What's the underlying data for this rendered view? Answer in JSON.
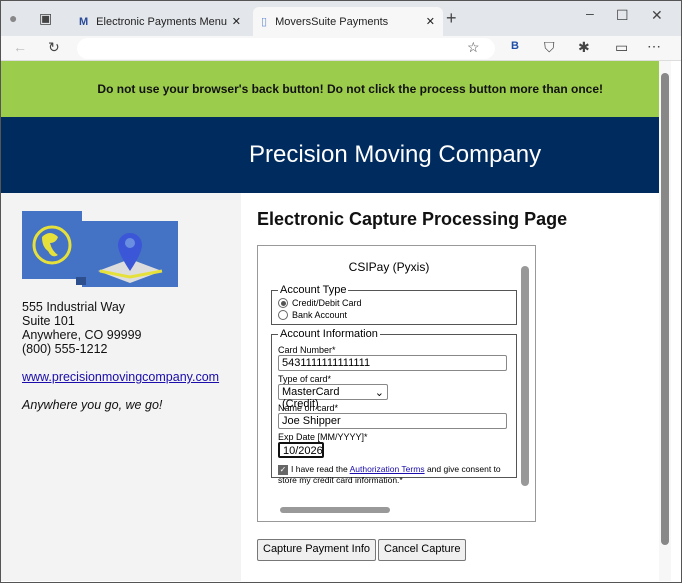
{
  "browser": {
    "tabs": [
      {
        "label": "Electronic Payments Menu"
      },
      {
        "label": "MoversSuite Payments"
      }
    ]
  },
  "banner": {
    "warning": "Do not use your browser's back button! Do not click the process button more than once!"
  },
  "header": {
    "company": "Precision Moving Company"
  },
  "sidebar": {
    "address1": "555 Industrial Way",
    "address2": "Suite 101",
    "address3": "Anywhere, CO 99999",
    "phone": "(800) 555-1212",
    "website": "www.precisionmovingcompany.com",
    "slogan": "Anywhere you go, we go!"
  },
  "main": {
    "title": "Electronic Capture Processing Page"
  },
  "form": {
    "provider": "CSIPay (Pyxis)",
    "account_type_legend": "Account Type",
    "opt_card": "Credit/Debit Card",
    "opt_bank": "Bank Account",
    "selected": "Credit/Debit Card",
    "account_info_legend": "Account Information",
    "card_number_label": "Card Number*",
    "card_number": "5431111111111111",
    "card_type_label": "Type of card*",
    "card_type": "MasterCard (Credit)",
    "name_label": "Name on card*",
    "name": "Joe Shipper",
    "exp_label": "Exp Date [MM/YYYY]*",
    "exp": "10/2026",
    "consent_pre": "I have read the ",
    "consent_link": "Authorization Terms",
    "consent_post": " and give consent to store my credit card information.*",
    "consent_checked": true
  },
  "buttons": {
    "capture": "Capture Payment Info",
    "cancel": "Cancel Capture"
  },
  "colors": {
    "banner": "#9ccc4c",
    "header": "#002b5e"
  }
}
